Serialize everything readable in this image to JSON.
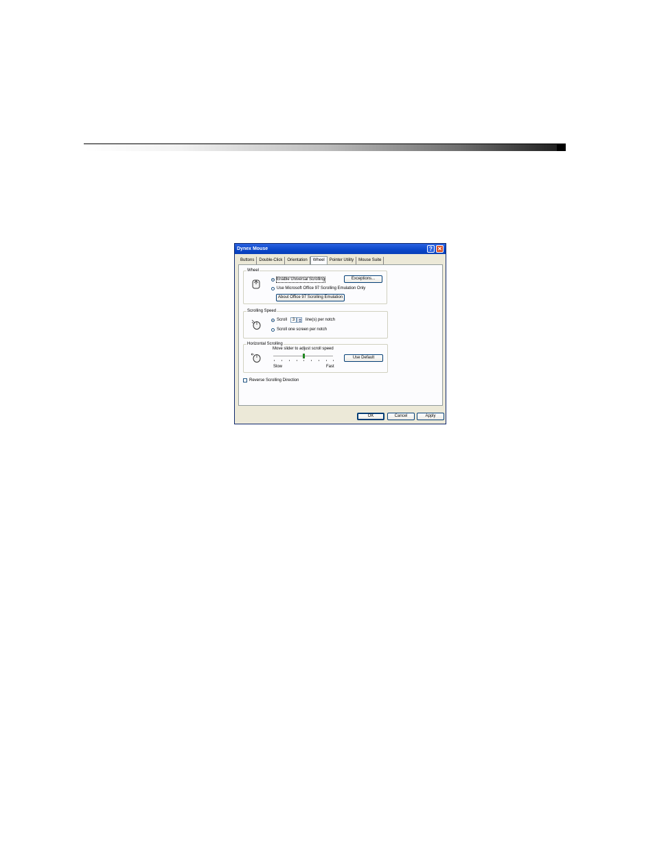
{
  "dialog": {
    "title": "Dynex Mouse",
    "tabs": [
      {
        "label": "Buttons"
      },
      {
        "label": "Double-Click"
      },
      {
        "label": "Orientation"
      },
      {
        "label": "Wheel"
      },
      {
        "label": "Pointer Utility"
      },
      {
        "label": "Mouse Suite"
      }
    ],
    "active_tab": "Wheel",
    "wheel_group": {
      "legend": "Wheel",
      "radio_universal": "Enable Universal Scrolling",
      "radio_office": "Use Microsoft Office 97 Scrolling Emulation Only",
      "exceptions_button": "Exceptions...",
      "about_button": "About Office 97 Scrolling Emulation",
      "selected": "universal"
    },
    "speed_group": {
      "legend": "Scrolling Speed",
      "radio_scroll": "Scroll",
      "scroll_lines": "3",
      "lines_suffix": "line(s) per notch",
      "radio_screen": "Scroll one screen per notch",
      "selected": "scroll"
    },
    "horizontal_group": {
      "legend": "Horizontal Scrolling",
      "hint": "Move slider to adjust scroll speed",
      "slow_label": "Slow",
      "fast_label": "Fast",
      "default_button": "Use Default",
      "slider_value": 0.5
    },
    "reverse_checkbox": "Reverse Scrolling Direction",
    "reverse_checked": false,
    "buttons": {
      "ok": "OK",
      "cancel": "Cancel",
      "apply": "Apply"
    },
    "icons": {
      "help": "?",
      "close": "✕"
    }
  }
}
